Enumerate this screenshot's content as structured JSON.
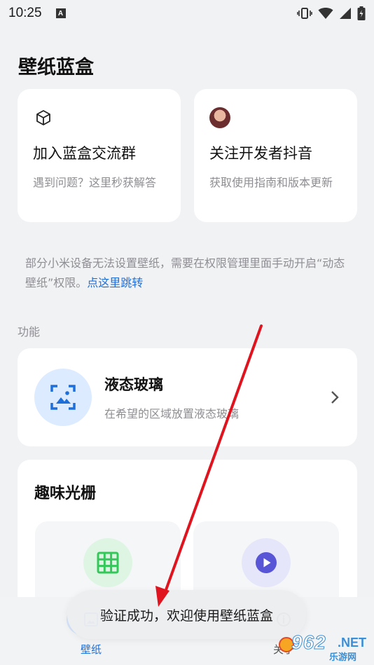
{
  "status_bar": {
    "time": "10:25",
    "notification_icon": "A",
    "icons": [
      "vibrate-icon",
      "wifi-icon",
      "signal-icon",
      "battery-charging-icon"
    ]
  },
  "app_title": "壁纸蓝盒",
  "cards": [
    {
      "title": "加入蓝盒交流群",
      "desc": "遇到问题？这里秒获解答",
      "icon": "cube-icon"
    },
    {
      "title": "关注开发者抖音",
      "desc": "获取使用指南和版本更新",
      "icon": "avatar-icon"
    }
  ],
  "notice": {
    "text": "部分小米设备无法设置壁纸，需要在权限管理里面手动开启“动态壁纸”权限。",
    "link": "点这里跳转"
  },
  "section_label": "功能",
  "feature": {
    "title": "液态玻璃",
    "desc": "在希望的区域放置液态玻璃",
    "icon": "image-frame-icon"
  },
  "fun_section": {
    "title": "趣味光栅",
    "tiles": [
      {
        "icon": "grid-icon",
        "icon_color": "#34c759",
        "bg": "#dff5e4"
      },
      {
        "icon": "play-icon",
        "icon_color": "#5856d6",
        "bg": "#e6e6fa"
      }
    ]
  },
  "bottom_nav": {
    "items": [
      {
        "label": "壁纸",
        "icon": "wallpaper-icon"
      },
      {
        "label": "关于",
        "icon": "about-icon"
      }
    ]
  },
  "toast": "验证成功，欢迎使用壁纸蓝盒",
  "colors": {
    "accent": "#1e6fd9",
    "annotation_arrow": "#e0141e",
    "background": "#f1f2f4"
  },
  "watermark": {
    "num": "962",
    "net": ".NET",
    "sub": "乐游网"
  }
}
